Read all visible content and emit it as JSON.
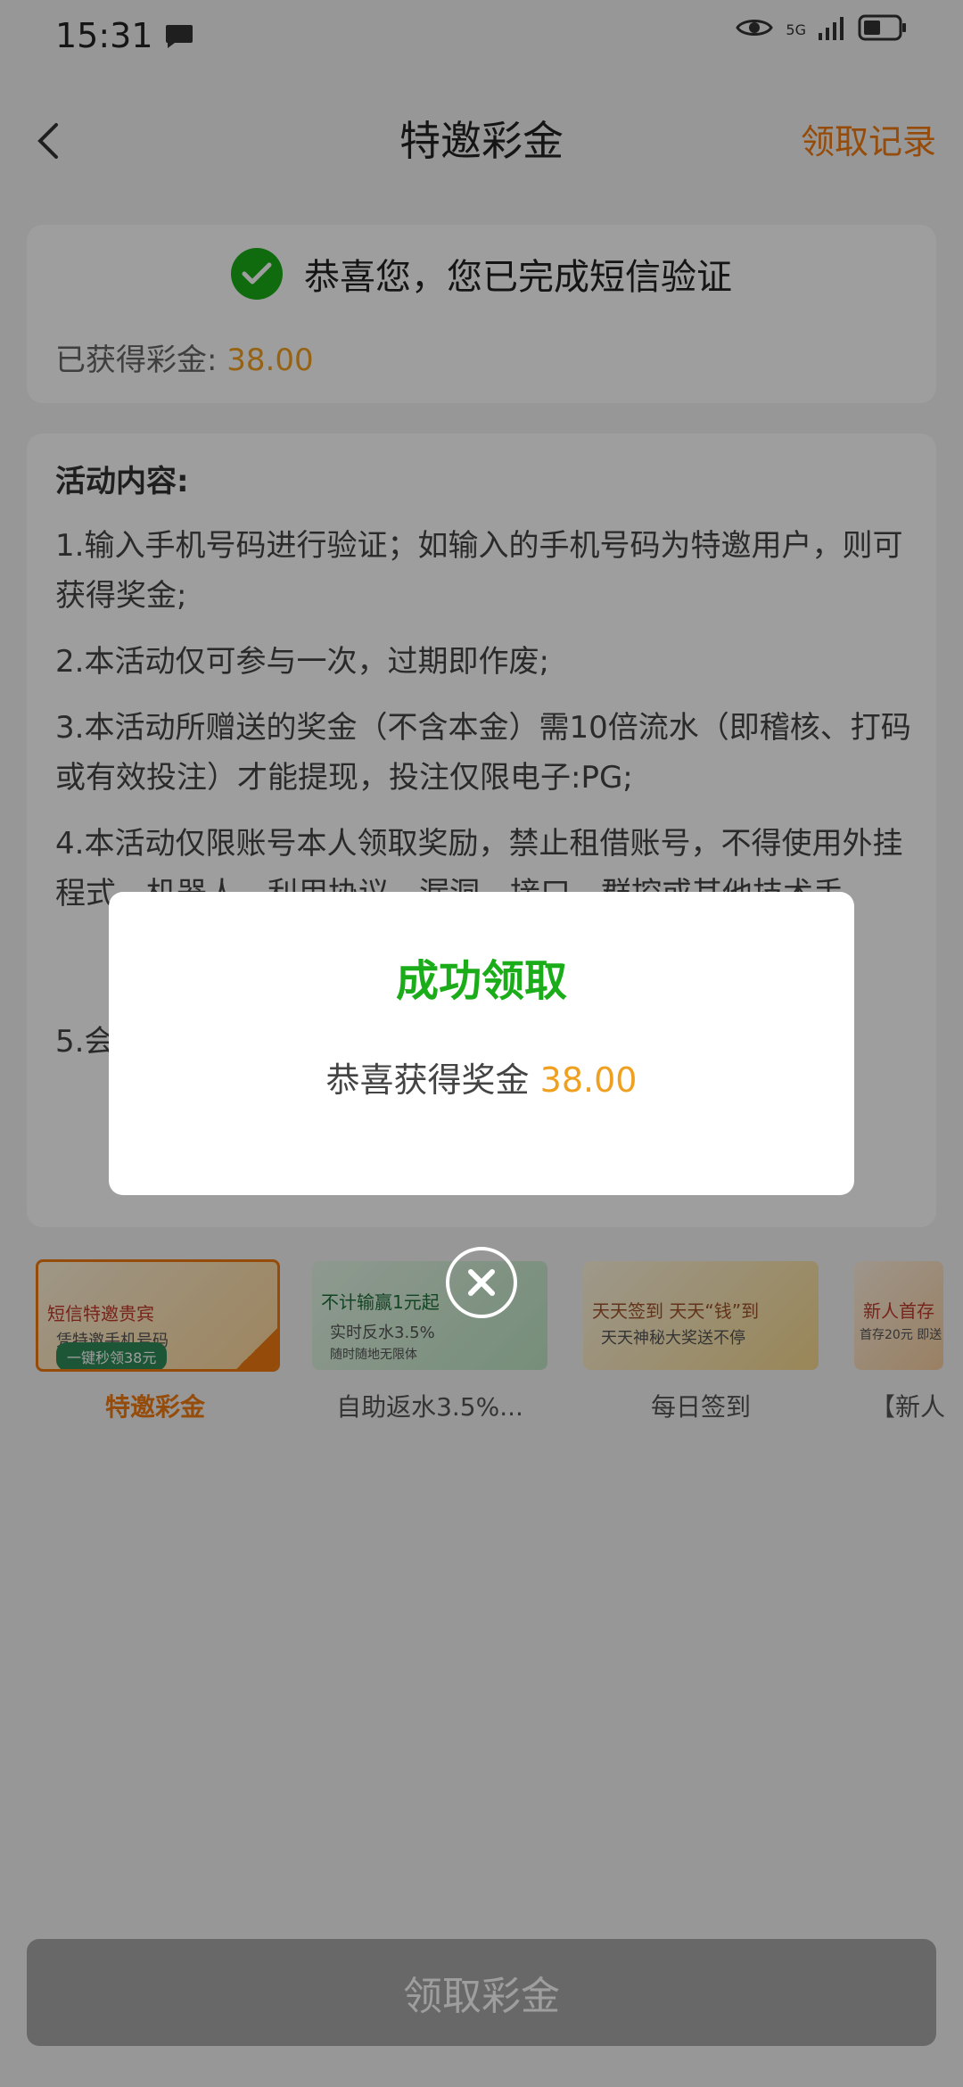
{
  "status_bar": {
    "time": "15:31",
    "network": "5G"
  },
  "header": {
    "title": "特邀彩金",
    "record_link": "领取记录"
  },
  "verify_card": {
    "message": "恭喜您，您已完成短信验证",
    "earned_label": "已获得彩金:",
    "earned_value": "38.00"
  },
  "activity": {
    "title": "活动内容:",
    "rules": [
      "1.输入手机号码进行验证；如输入的手机号码为特邀用户，则可获得奖金;",
      "2.本活动仅可参与一次，过期即作废;",
      "3.本活动所赠送的奖金（不含本金）需10倍流水（即稽核、打码或有效投注）才能提现，投注仅限电子:PG;",
      "4.本活动仅限账号本人领取奖励，禁止租借账号，不得使用外挂程式、机器人、利用协议、漏洞、接口、群控或其他技术手",
      "5.会"
    ]
  },
  "thumbnails": [
    {
      "label": "特邀彩金",
      "banner_title": "短信特邀贵宾",
      "banner_sub": "凭特邀手机号码",
      "banner_pill": "一键秒领38元",
      "selected": true
    },
    {
      "label": "自助返水3.5%...",
      "banner_title": "不计输赢1元起",
      "banner_sub": "实时反水3.5%",
      "banner_pill": "随时随地无限体"
    },
    {
      "label": "每日签到",
      "banner_title": "天天签到 天天“钱”到",
      "banner_sub": "天天神秘大奖送不停"
    },
    {
      "label": "【新人",
      "banner_title": "新人首存",
      "banner_sub": "首存20元 即送"
    }
  ],
  "claim_button": {
    "label": "领取彩金"
  },
  "dialog": {
    "title": "成功领取",
    "message": "恭喜获得奖金",
    "value": "38.00"
  },
  "colors": {
    "accent_orange": "#f07a10",
    "success_green": "#1aad19",
    "amount_gold": "#f0a020"
  }
}
